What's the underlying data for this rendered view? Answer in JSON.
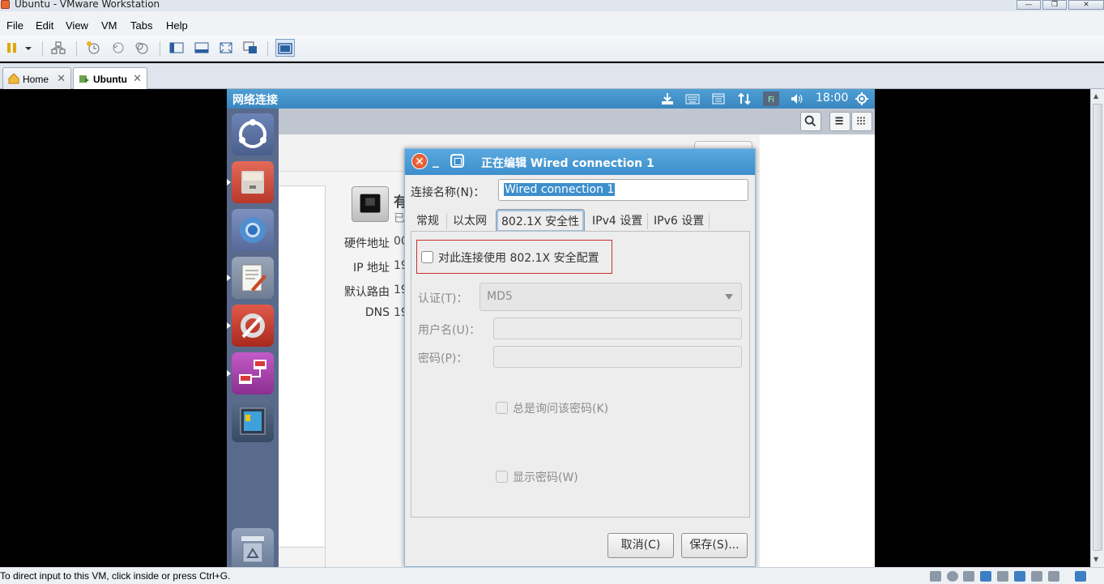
{
  "window": {
    "title": "Ubuntu - VMware Workstation",
    "buttons": [
      "minimize",
      "restore",
      "close"
    ]
  },
  "menu": {
    "items": [
      "File",
      "Edit",
      "View",
      "VM",
      "Tabs",
      "Help"
    ]
  },
  "toolbar": {
    "icons": [
      "pause-icon",
      "dropdown-icon",
      "network-icon",
      "snapshot-icon",
      "revert-icon",
      "snapshot-manager-icon",
      "sidebar-icon",
      "thumbnail-icon",
      "fullscreen-icon",
      "unity-icon",
      "console-view-icon"
    ]
  },
  "tabs": [
    {
      "label": "Home",
      "close": "✕"
    },
    {
      "label": "Ubuntu",
      "close": "✕"
    }
  ],
  "status": {
    "text": "To direct input to this VM, click inside or press Ctrl+G."
  },
  "guest": {
    "topbar": {
      "title": "网络连接",
      "time": "18:00"
    },
    "background_window": {
      "device_title_partial": "有",
      "device_sub_partial": "已",
      "rows": [
        {
          "label": "硬件地址",
          "value": "00"
        },
        {
          "label": "IP 地址",
          "value": "19"
        },
        {
          "label": "默认路由",
          "value": "19"
        },
        {
          "label": "DNS",
          "value": "19"
        }
      ]
    }
  },
  "dialog": {
    "title": "正在编辑 Wired connection 1",
    "close_glyph": "✕",
    "connection_name_label": "连接名称(N)：",
    "connection_name_value": "Wired connection 1",
    "tabs": [
      "常规",
      "以太网",
      "802.1X 安全性",
      "IPv4 设置",
      "IPv6 设置"
    ],
    "active_tab": "802.1X 安全性",
    "use_8021x_label": "对此连接使用 802.1X 安全配置",
    "use_8021x_checked": false,
    "auth_label": "认证(T)：",
    "auth_value": "MD5",
    "username_label": "用户名(U)：",
    "username_value": "",
    "password_label": "密码(P)：",
    "password_value": "",
    "always_ask_label": "总是询问该密码(K)",
    "show_password_label": "显示密码(W)",
    "cancel_label": "取消(C)",
    "save_label": "保存(S)..."
  },
  "colors": {
    "ubuntu_topbar": "#3a86c0",
    "dialog_title": "#3d8fcc",
    "launcher": "#5a6a8c",
    "highlight_box": "#cc2d2d"
  }
}
